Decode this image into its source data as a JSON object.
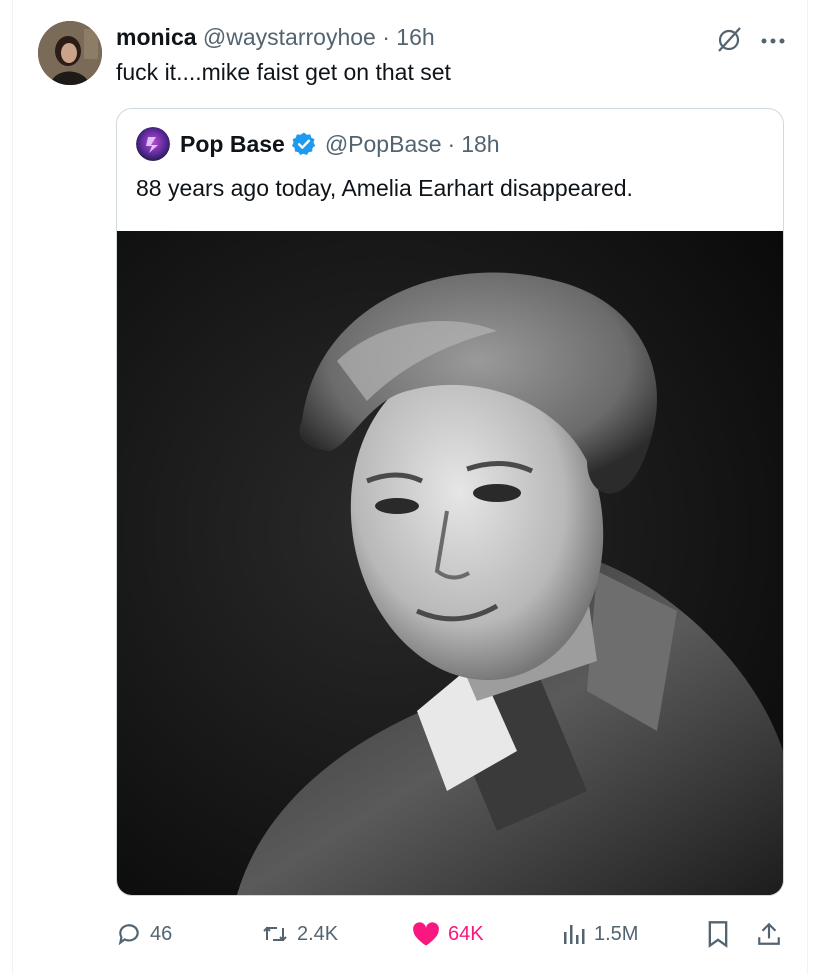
{
  "tweet": {
    "display_name": "monica",
    "handle": "@waystarroyhoe",
    "separator": "·",
    "time": "16h",
    "text": "fuck it....mike faist get on that set"
  },
  "quoted_tweet": {
    "display_name": "Pop Base",
    "handle": "@PopBase",
    "separator": "·",
    "time": "18h",
    "text": "88 years ago today, Amelia Earhart disappeared."
  },
  "actions": {
    "replies": "46",
    "reposts": "2.4K",
    "likes": "64K",
    "views": "1.5M"
  },
  "icons": [
    "grok-icon",
    "more-icon",
    "verified-icon",
    "reply-icon",
    "repost-icon",
    "heart-icon",
    "views-icon",
    "bookmark-icon",
    "share-icon"
  ],
  "colors": {
    "like_pink": "#f91880",
    "verified_blue": "#1d9bf0",
    "muted": "#536471"
  }
}
